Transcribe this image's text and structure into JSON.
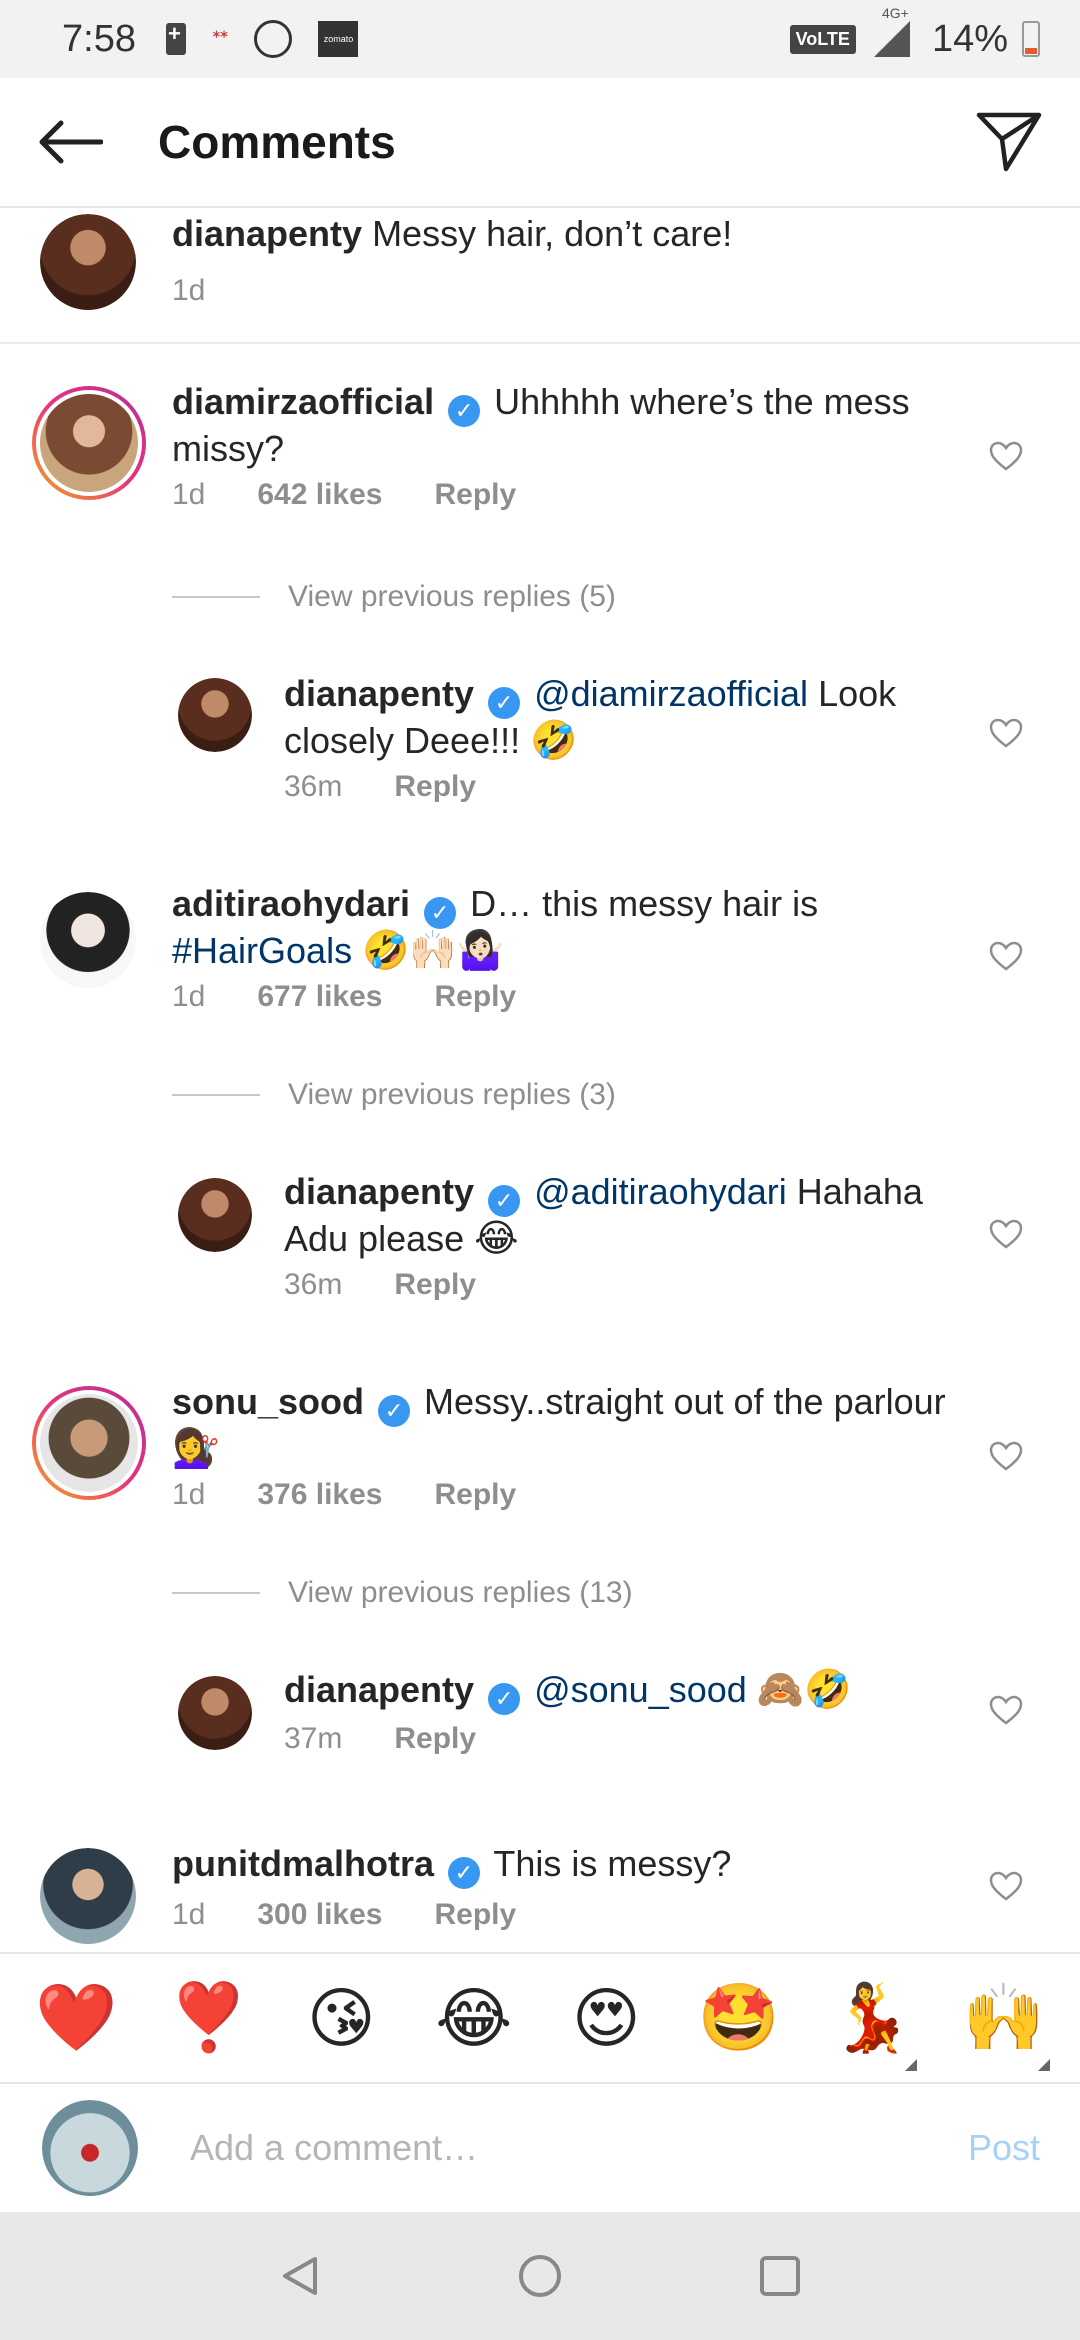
{
  "status_bar": {
    "time": "7:58",
    "zomato_label": "zomato",
    "volte": "VoLTE",
    "network": "4G+",
    "battery": "14%"
  },
  "header": {
    "title": "Comments"
  },
  "comments": [
    {
      "username": "dianapenty",
      "verified": false,
      "text": "Messy hair, don’t care!",
      "time": "1d"
    },
    {
      "username": "diamirzaofficial",
      "verified": true,
      "text": "Uhhhhh where’s the mess missy?",
      "time": "1d",
      "likes": "642 likes",
      "reply_label": "Reply",
      "view_replies": "View previous replies (5)",
      "reply": {
        "username": "dianapenty",
        "verified": true,
        "mention": "@diamirzaofficial",
        "text": "Look closely Deee!!!",
        "emoji": "🤣",
        "time": "36m",
        "reply_label": "Reply"
      }
    },
    {
      "username": "aditiraohydari",
      "verified": true,
      "text": "D… this messy hair is",
      "hashtag": "#HairGoals",
      "emoji": "🤣🙌🏻🤷🏻‍♀️",
      "time": "1d",
      "likes": "677 likes",
      "reply_label": "Reply",
      "view_replies": "View previous replies (3)",
      "reply": {
        "username": "dianapenty",
        "verified": true,
        "mention": "@aditiraohydari",
        "text": "Hahaha Adu please",
        "emoji": "😂",
        "time": "36m",
        "reply_label": "Reply"
      }
    },
    {
      "username": "sonu_sood",
      "verified": true,
      "text": "Messy..straight out of the parlour",
      "emoji": "💇‍♀️",
      "time": "1d",
      "likes": "376 likes",
      "reply_label": "Reply",
      "view_replies": "View previous replies (13)",
      "reply": {
        "username": "dianapenty",
        "verified": true,
        "mention": "@sonu_sood",
        "text": "",
        "emoji": "🙈🤣",
        "time": "37m",
        "reply_label": "Reply"
      }
    },
    {
      "username": "punitdmalhotra",
      "verified": true,
      "text": "This is messy?",
      "time": "1d",
      "likes": "300 likes",
      "reply_label": "Reply"
    }
  ],
  "reactions": [
    "❤️",
    "❣️",
    "😘",
    "😂",
    "😍",
    "🤩",
    "💃",
    "🙌"
  ],
  "composer": {
    "placeholder": "Add a comment…",
    "post_label": "Post"
  },
  "icons": {
    "back": "back-arrow-icon",
    "send": "send-icon",
    "heart": "heart-outline-icon",
    "verified": "verified-badge-icon"
  },
  "colors": {
    "verified_blue": "#3897f0",
    "mention": "#003569",
    "post_disabled": "#a8d1f7",
    "meta_gray": "#8e8e8e"
  }
}
